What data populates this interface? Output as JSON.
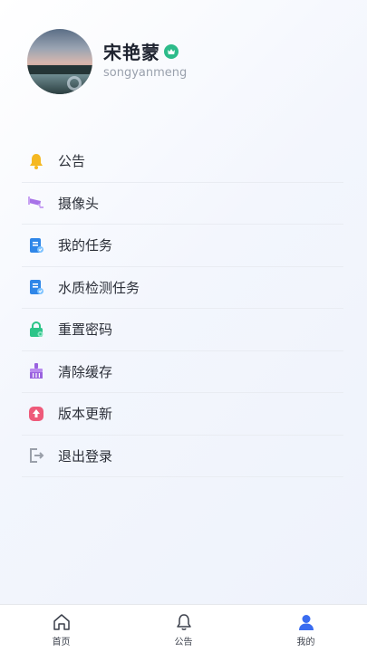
{
  "profile": {
    "name": "宋艳蒙",
    "username": "songyanmeng",
    "badge_icon": "crown-badge-icon"
  },
  "menu": {
    "items": [
      {
        "label": "公告",
        "icon": "bell-icon",
        "color": "#f5b822"
      },
      {
        "label": "摄像头",
        "icon": "camera-icon",
        "color": "#a772e8"
      },
      {
        "label": "我的任务",
        "icon": "task-doc-icon",
        "color": "#2f86e8"
      },
      {
        "label": "水质检测任务",
        "icon": "water-task-icon",
        "color": "#2f86e8"
      },
      {
        "label": "重置密码",
        "icon": "lock-icon",
        "color": "#2cc488"
      },
      {
        "label": "清除缓存",
        "icon": "broom-icon",
        "color": "#9a63df"
      },
      {
        "label": "版本更新",
        "icon": "update-icon",
        "color": "#ee5a7a"
      },
      {
        "label": "退出登录",
        "icon": "logout-icon",
        "color": "#9aa0aa"
      }
    ]
  },
  "tabbar": {
    "tabs": [
      {
        "label": "首页",
        "icon": "home-icon",
        "active": false
      },
      {
        "label": "公告",
        "icon": "bell-outline-icon",
        "active": false
      },
      {
        "label": "我的",
        "icon": "user-icon",
        "active": true
      }
    ],
    "active_color": "#3a6cf0"
  }
}
